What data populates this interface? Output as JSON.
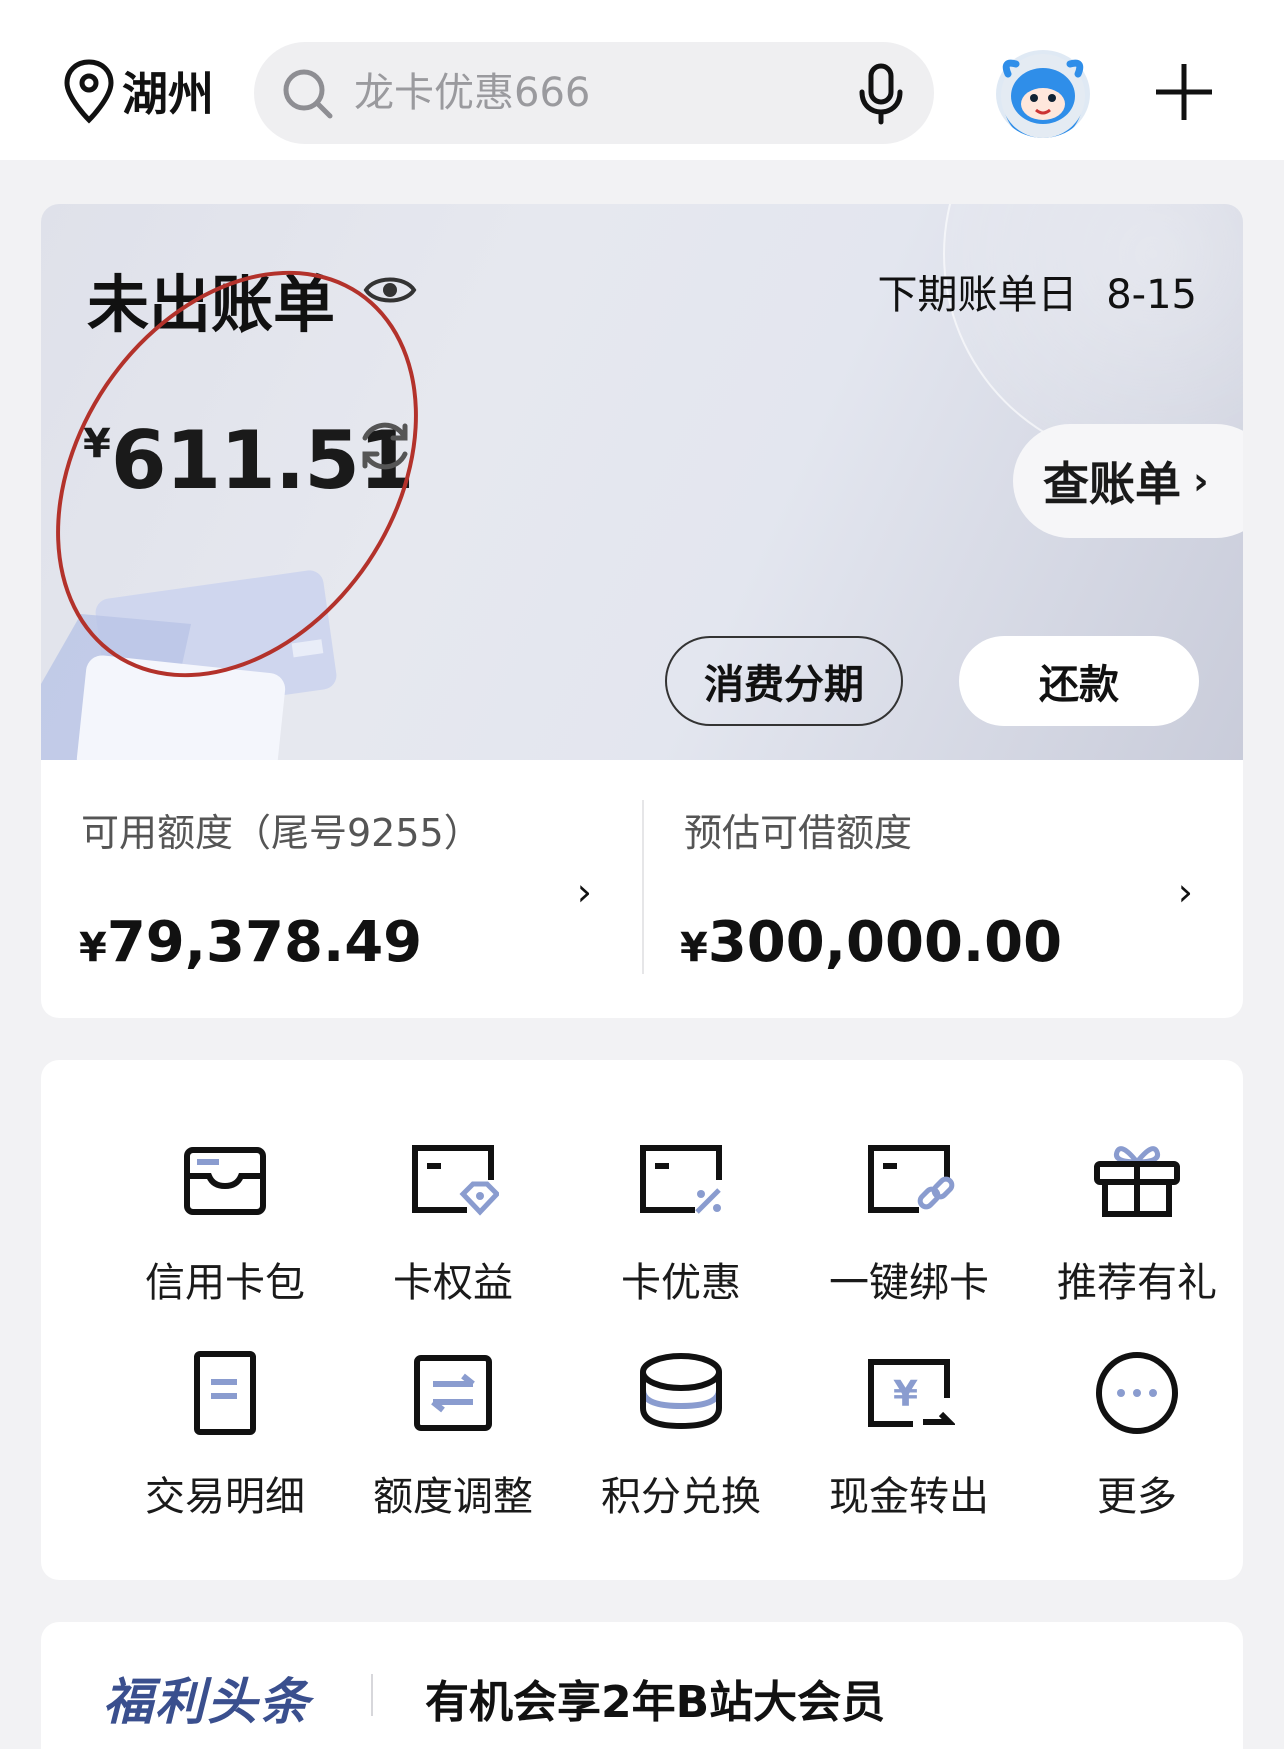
{
  "header": {
    "location": "湖州",
    "search_placeholder": "龙卡优惠666"
  },
  "bill": {
    "title": "未出账单",
    "next_bill_label": "下期账单日",
    "next_bill_date": "8-15",
    "currency": "¥",
    "amount": "611.51",
    "check_bill_label": "查账单",
    "installment_label": "消费分期",
    "repay_label": "还款",
    "annotation_color": "#b3322b"
  },
  "limits": {
    "available_label": "可用额度（尾号9255）",
    "available_currency": "¥",
    "available_value": "79,378.49",
    "borrow_label": "预估可借额度",
    "borrow_currency": "¥",
    "borrow_value": "300,000.00"
  },
  "grid": {
    "items": [
      {
        "label": "信用卡包",
        "icon": "card-wallet-icon"
      },
      {
        "label": "卡权益",
        "icon": "card-benefit-icon"
      },
      {
        "label": "卡优惠",
        "icon": "card-discount-icon"
      },
      {
        "label": "一键绑卡",
        "icon": "bind-card-icon"
      },
      {
        "label": "推荐有礼",
        "icon": "gift-icon"
      },
      {
        "label": "交易明细",
        "icon": "transaction-detail-icon"
      },
      {
        "label": "额度调整",
        "icon": "limit-adjust-icon"
      },
      {
        "label": "积分兑换",
        "icon": "points-exchange-icon"
      },
      {
        "label": "现金转出",
        "icon": "cash-transfer-icon"
      },
      {
        "label": "更多",
        "icon": "more-icon"
      }
    ]
  },
  "news": {
    "brand": "福利头条",
    "headline": "有机会享2年B站大会员"
  },
  "colors": {
    "accent_blue": "#8a9ccf",
    "brand_blue": "#3a4f8e"
  }
}
